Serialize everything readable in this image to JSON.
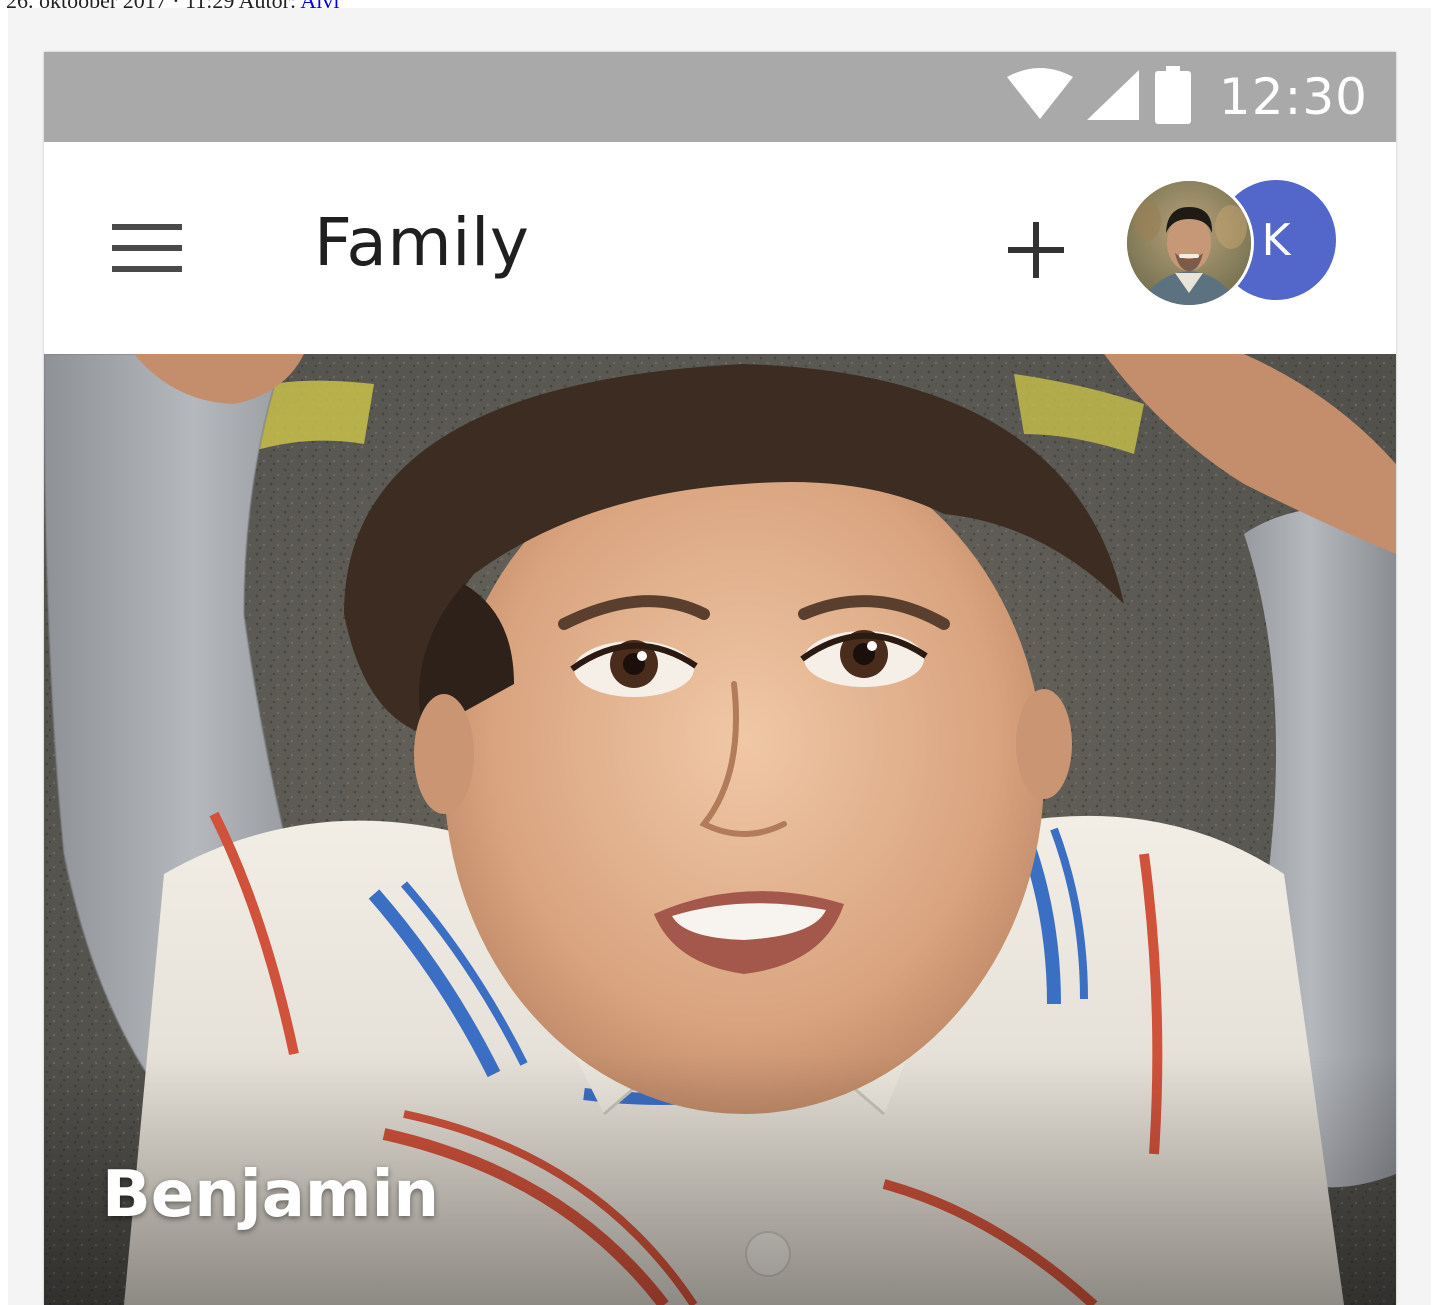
{
  "caption": {
    "text": "26. oktoober 2017 · 11:29 Autor:",
    "author_link": "Aivi"
  },
  "status_bar": {
    "time": "12:30",
    "icons": [
      "wifi-icon",
      "cellular-signal-icon",
      "battery-icon"
    ]
  },
  "app_bar": {
    "title": "Family",
    "menu_icon": "hamburger-menu-icon",
    "add_icon": "plus-icon",
    "avatars": [
      {
        "type": "photo",
        "description": "user-photo-avatar"
      },
      {
        "type": "initial",
        "initial": "K",
        "color": "#5366c9"
      }
    ]
  },
  "card": {
    "name": "Benjamin"
  },
  "colors": {
    "status_bar": "#a9a9a9",
    "app_bar": "#ffffff",
    "avatar_accent": "#5366c9",
    "background": "#f4f4f4"
  }
}
